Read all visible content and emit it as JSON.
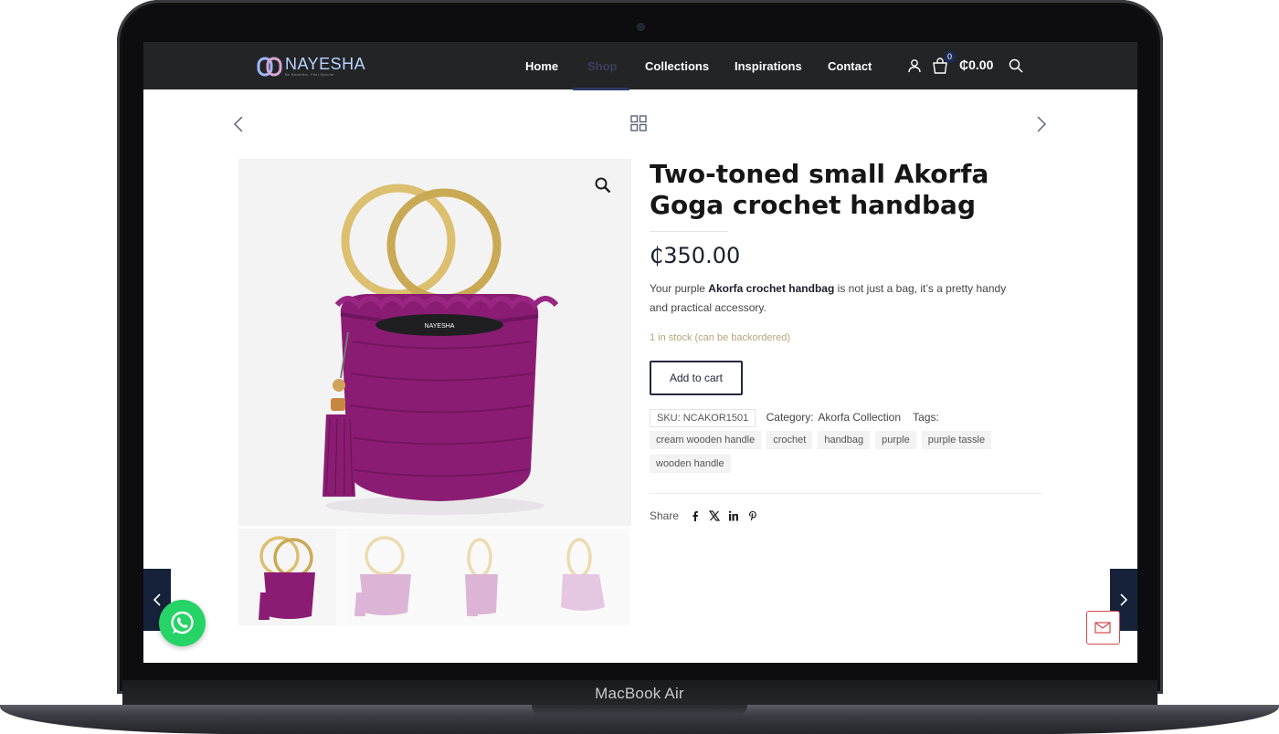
{
  "device": {
    "model_label": "MacBook Air"
  },
  "header": {
    "logo_name": "NAYESHA",
    "logo_tagline": "Be Beautiful, Feel Special",
    "nav": [
      "Home",
      "Shop",
      "Collections",
      "Inspirations",
      "Contact"
    ],
    "active_nav": "Shop",
    "cart_count": "0",
    "cart_total": "₵0.00"
  },
  "product": {
    "title": "Two-toned small Akorfa Goga crochet handbag",
    "price": "₵350.00",
    "description_prefix": "Your purple ",
    "description_bold": "Akorfa crochet handbag",
    "description_suffix": " is not just a bag, it’s a pretty handy and practical accessory.",
    "stock": "1 in stock (can be backordered)",
    "add_to_cart": "Add to cart",
    "sku": "SKU: NCAKOR1501",
    "category_label": "Category:",
    "category": "Akorfa Collection",
    "tags_label": "Tags:",
    "tags": [
      "cream wooden handle",
      "crochet",
      "handbag",
      "purple",
      "purple tassle",
      "wooden handle"
    ],
    "share_label": "Share",
    "label_on_bag": "NAYESHA"
  },
  "colors": {
    "header_bg": "#232426",
    "bag_purple": "#8b1c73",
    "accent_navy": "#16223a",
    "whatsapp_green": "#25d366",
    "stock_text": "#b7a57a"
  },
  "icons": [
    "user-icon",
    "cart-icon",
    "search-icon",
    "grid-icon",
    "zoom-icon",
    "facebook-icon",
    "x-icon",
    "linkedin-icon",
    "pinterest-icon",
    "whatsapp-icon",
    "mail-icon"
  ]
}
